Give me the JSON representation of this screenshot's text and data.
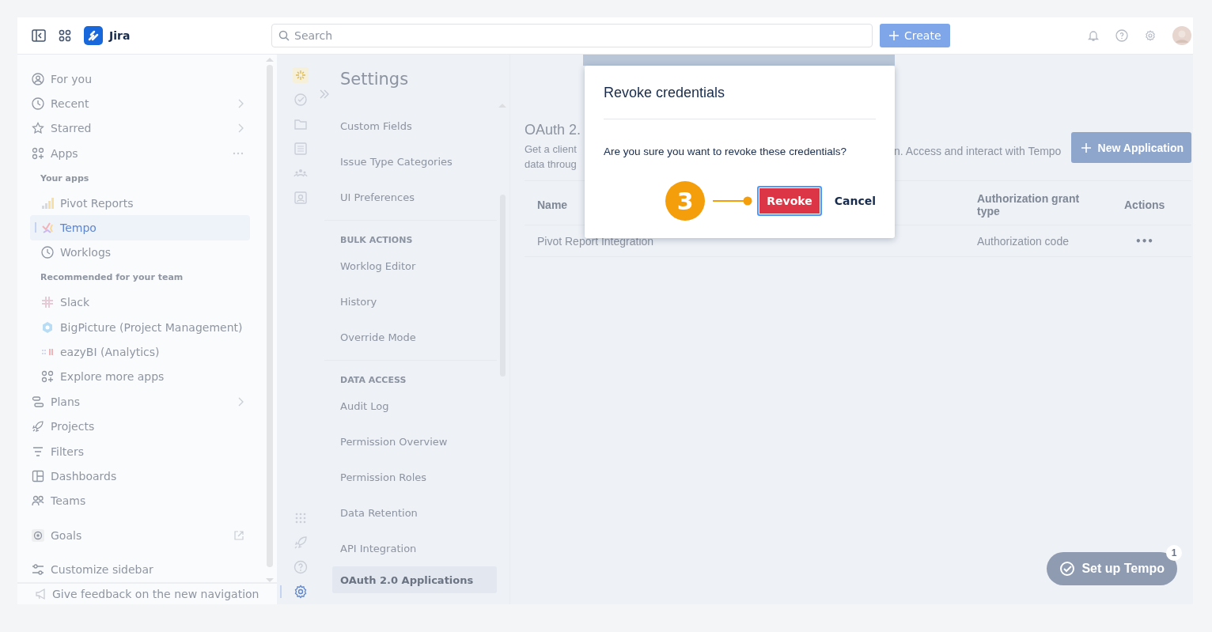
{
  "topbar": {
    "app_name": "Jira",
    "search": {
      "placeholder": "Search"
    },
    "create_button": "Create"
  },
  "sidebar": {
    "items": [
      {
        "kind": "nav",
        "label": "For you",
        "selected": false
      },
      {
        "kind": "nav",
        "label": "Recent",
        "selected": false,
        "chevron": true
      },
      {
        "kind": "nav",
        "label": "Starred",
        "selected": false,
        "chevron": true
      },
      {
        "kind": "nav",
        "label": "Apps",
        "selected": false,
        "more_menu": true
      },
      {
        "kind": "section",
        "label": "Your apps"
      },
      {
        "kind": "app",
        "label": "Pivot Reports",
        "selected": false
      },
      {
        "kind": "app",
        "label": "Tempo",
        "selected": true
      },
      {
        "kind": "app",
        "label": "Worklogs",
        "selected": false
      },
      {
        "kind": "section",
        "label": "Recommended for your team"
      },
      {
        "kind": "app",
        "label": "Slack",
        "selected": false
      },
      {
        "kind": "app",
        "label": "BigPicture (Project Management)",
        "selected": false
      },
      {
        "kind": "app",
        "label": "eazyBI (Analytics)",
        "selected": false
      },
      {
        "kind": "app",
        "label": "Explore more apps",
        "selected": false
      },
      {
        "kind": "nav",
        "label": "Plans",
        "selected": false,
        "chevron": true
      },
      {
        "kind": "nav",
        "label": "Projects",
        "selected": false
      },
      {
        "kind": "nav",
        "label": "Filters",
        "selected": false
      },
      {
        "kind": "nav",
        "label": "Dashboards",
        "selected": false
      },
      {
        "kind": "nav",
        "label": "Teams",
        "selected": false
      },
      {
        "kind": "gap"
      },
      {
        "kind": "nav",
        "label": "Goals",
        "selected": false,
        "external_link": true
      },
      {
        "kind": "gap"
      },
      {
        "kind": "nav",
        "label": "Customize sidebar",
        "selected": false
      }
    ],
    "footer": "Give feedback on the new navigation"
  },
  "rail": {
    "top": [
      {
        "selected": false
      },
      {
        "selected": false
      },
      {
        "selected": false
      },
      {
        "selected": false
      },
      {
        "selected": false
      },
      {
        "selected": false
      }
    ],
    "bottom": [
      {
        "selected": false
      },
      {
        "selected": false
      },
      {
        "selected": false
      },
      {
        "selected": true
      }
    ]
  },
  "settings_menu": {
    "title": "Settings",
    "groups": [
      {
        "items": [
          {
            "label": "Custom Fields",
            "selected": false
          },
          {
            "label": "Issue Type Categories",
            "selected": false
          },
          {
            "label": "UI Preferences",
            "selected": false
          }
        ]
      },
      {
        "heading": "BULK ACTIONS",
        "items": [
          {
            "label": "Worklog Editor",
            "selected": false
          },
          {
            "label": "History",
            "selected": false
          },
          {
            "label": "Override Mode",
            "selected": false
          }
        ]
      },
      {
        "heading": "DATA ACCESS",
        "items": [
          {
            "label": "Audit Log",
            "selected": false
          },
          {
            "label": "Permission Overview",
            "selected": false
          },
          {
            "label": "Permission Roles",
            "selected": false
          },
          {
            "label": "Data Retention",
            "selected": false
          },
          {
            "label": "API Integration",
            "selected": false
          },
          {
            "label": "OAuth 2.0 Applications",
            "selected": true
          }
        ]
      }
    ]
  },
  "content": {
    "title_visible": "OAuth 2.",
    "description_left": [
      "Get a client",
      "data throug"
    ],
    "description_right": "n. Access and interact with Tempo",
    "new_application_button": "New Application",
    "table": {
      "columns": [
        "Name",
        "Authorization grant type",
        "Actions"
      ],
      "rows": [
        {
          "name": "Pivot Report Integration",
          "authorization_grant_type": "Authorization code",
          "actions": "•••"
        }
      ]
    },
    "setup_button": "Set up Tempo",
    "setup_badge": "1"
  },
  "dialog": {
    "title": "Revoke credentials",
    "message": "Are you sure you want to revoke these credentials?",
    "confirm_button": "Revoke",
    "cancel_button": "Cancel",
    "step_marker": "3"
  }
}
